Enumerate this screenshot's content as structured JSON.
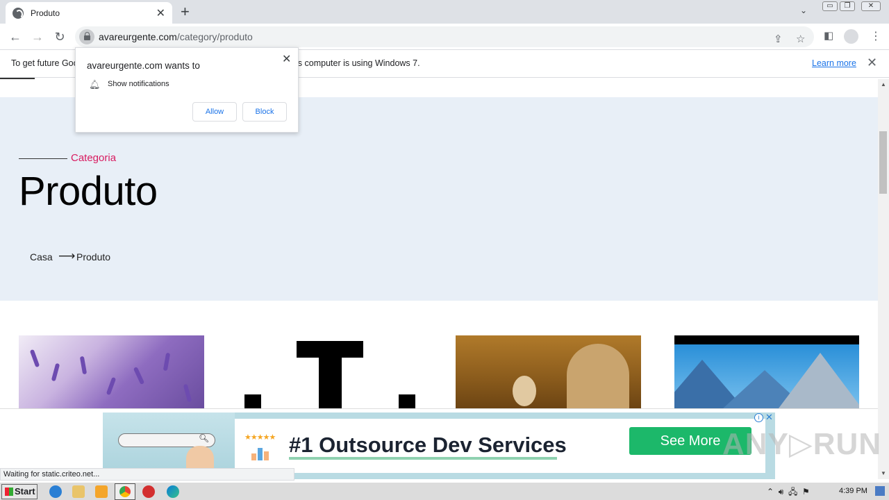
{
  "browser": {
    "tab_title": "Produto",
    "url_domain": "avareurgente.com",
    "url_path": "/category/produto",
    "status_text": "Waiting for static.criteo.net..."
  },
  "infobar": {
    "text": "To get future Google Chrome updates, you'll need Windows 10 or later. This computer is using Windows 7.",
    "link": "Learn more"
  },
  "notification": {
    "title": "avareurgente.com wants to",
    "permission": "Show notifications",
    "allow": "Allow",
    "block": "Block"
  },
  "page": {
    "category_label": "Categoria",
    "title": "Produto",
    "breadcrumb": {
      "home": "Casa",
      "arrow": "⟶",
      "current": "Produto"
    }
  },
  "ad": {
    "headline": "#1 Outsource Dev Services",
    "cta": "See More",
    "info": "i",
    "close": "✕"
  },
  "watermark": "ANY▷RUN",
  "taskbar": {
    "start": "Start",
    "time": "4:39 PM"
  },
  "icons": {
    "back": "arrow-left-icon",
    "forward": "arrow-right-icon",
    "reload": "reload-icon",
    "lock": "lock-icon",
    "share": "share-icon",
    "bookmark": "star-icon",
    "sidepanel": "side-panel-icon",
    "profile": "profile-icon",
    "menu": "kebab-menu-icon",
    "bell": "bell-icon"
  },
  "colors": {
    "accent_category": "#d81b60",
    "hero_bg": "#e8eff7",
    "ad_cta": "#1cb86a",
    "link_blue": "#1a73e8"
  }
}
